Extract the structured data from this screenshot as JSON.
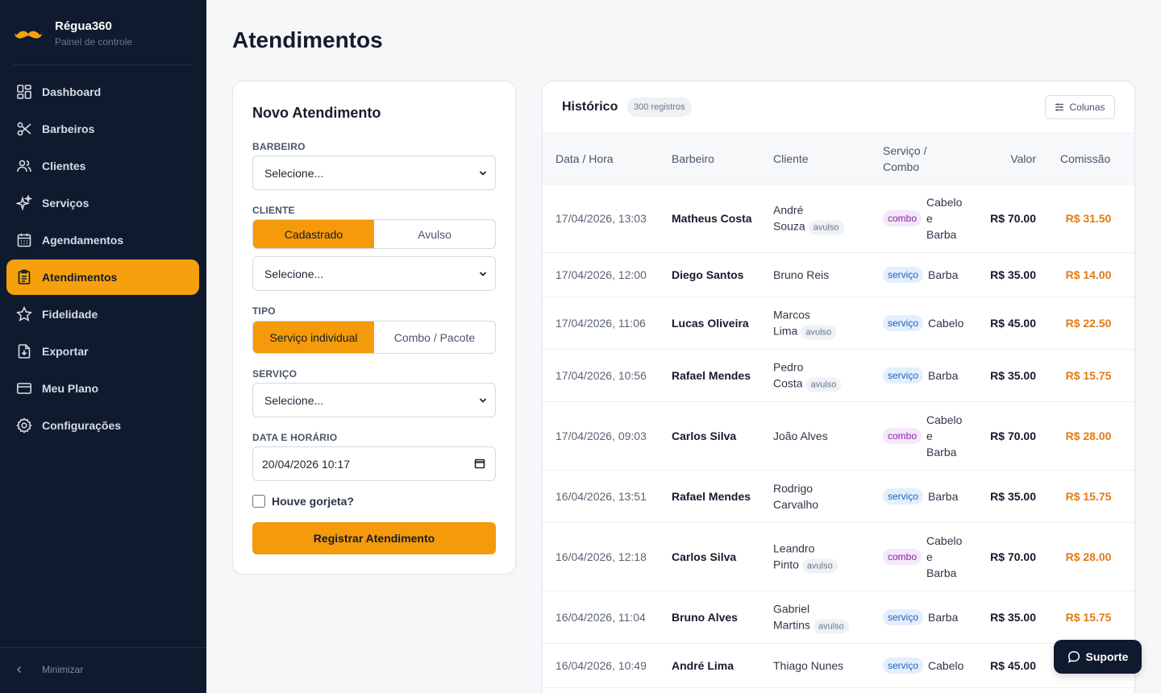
{
  "brand": {
    "name": "Régua360",
    "subtitle": "Painel de controle"
  },
  "sidebar": {
    "items": [
      {
        "label": "Dashboard",
        "icon": "dashboard-icon"
      },
      {
        "label": "Barbeiros",
        "icon": "scissors-icon"
      },
      {
        "label": "Clientes",
        "icon": "users-icon"
      },
      {
        "label": "Serviços",
        "icon": "sparkles-icon"
      },
      {
        "label": "Agendamentos",
        "icon": "calendar-icon"
      },
      {
        "label": "Atendimentos",
        "icon": "clipboard-icon",
        "active": true
      },
      {
        "label": "Fidelidade",
        "icon": "star-icon"
      },
      {
        "label": "Exportar",
        "icon": "export-icon"
      },
      {
        "label": "Meu Plano",
        "icon": "credit-card-icon"
      },
      {
        "label": "Configurações",
        "icon": "gear-icon"
      }
    ],
    "minimize_label": "Minimizar"
  },
  "page": {
    "title": "Atendimentos"
  },
  "form": {
    "title": "Novo Atendimento",
    "barbeiro_label": "BARBEIRO",
    "barbeiro_value": "Selecione...",
    "cliente_label": "CLIENTE",
    "cliente_opt_1": "Cadastrado",
    "cliente_opt_2": "Avulso",
    "cliente_value": "Selecione...",
    "tipo_label": "TIPO",
    "tipo_opt_1": "Serviço individual",
    "tipo_opt_2": "Combo / Pacote",
    "servico_label": "SERVIÇO",
    "servico_value": "Selecione...",
    "data_label": "DATA E HORÁRIO",
    "data_value": "20/04/2026 10:17",
    "gorjeta_label": "Houve gorjeta?",
    "submit_label": "Registrar Atendimento"
  },
  "history": {
    "title": "Histórico",
    "count": "300 registros",
    "columns_button": "Colunas",
    "headers": {
      "data": "Data / Hora",
      "barbeiro": "Barbeiro",
      "cliente": "Cliente",
      "servico_1": "Serviço /",
      "servico_2": "Combo",
      "valor": "Valor",
      "comissao": "Comissão"
    },
    "rows": [
      {
        "data": "17/04/2026, 13:03",
        "barbeiro": "Matheus Costa",
        "cliente_1": "André",
        "cliente_2": "Souza",
        "avulso": "avulso",
        "tag": "combo",
        "servico_1": "Cabelo",
        "servico_2": "e",
        "servico_3": "Barba",
        "valor": "R$ 70.00",
        "comissao": "R$ 31.50"
      },
      {
        "data": "17/04/2026, 12:00",
        "barbeiro": "Diego Santos",
        "cliente_1": "Bruno Reis",
        "tag": "serviço",
        "servico_1": "Barba",
        "valor": "R$ 35.00",
        "comissao": "R$ 14.00"
      },
      {
        "data": "17/04/2026, 11:06",
        "barbeiro": "Lucas Oliveira",
        "cliente_1": "Marcos",
        "cliente_2": "Lima",
        "avulso": "avulso",
        "tag": "serviço",
        "servico_1": "Cabelo",
        "valor": "R$ 45.00",
        "comissao": "R$ 22.50"
      },
      {
        "data": "17/04/2026, 10:56",
        "barbeiro": "Rafael Mendes",
        "cliente_1": "Pedro",
        "cliente_2": "Costa",
        "avulso": "avulso",
        "tag": "serviço",
        "servico_1": "Barba",
        "valor": "R$ 35.00",
        "comissao": "R$ 15.75"
      },
      {
        "data": "17/04/2026, 09:03",
        "barbeiro": "Carlos Silva",
        "cliente_1": "João Alves",
        "tag": "combo",
        "servico_1": "Cabelo",
        "servico_2": "e",
        "servico_3": "Barba",
        "valor": "R$ 70.00",
        "comissao": "R$ 28.00"
      },
      {
        "data": "16/04/2026, 13:51",
        "barbeiro": "Rafael Mendes",
        "cliente_1": "Rodrigo",
        "cliente_2": "Carvalho",
        "tag": "serviço",
        "servico_1": "Barba",
        "valor": "R$ 35.00",
        "comissao": "R$ 15.75"
      },
      {
        "data": "16/04/2026, 12:18",
        "barbeiro": "Carlos Silva",
        "cliente_1": "Leandro",
        "cliente_2": "Pinto",
        "avulso": "avulso",
        "tag": "combo",
        "servico_1": "Cabelo",
        "servico_2": "e",
        "servico_3": "Barba",
        "valor": "R$ 70.00",
        "comissao": "R$ 28.00"
      },
      {
        "data": "16/04/2026, 11:04",
        "barbeiro": "Bruno Alves",
        "cliente_1": "Gabriel",
        "cliente_2": "Martins",
        "avulso": "avulso",
        "tag": "serviço",
        "servico_1": "Barba",
        "valor": "R$ 35.00",
        "comissao": "R$ 15.75"
      },
      {
        "data": "16/04/2026, 10:49",
        "barbeiro": "André Lima",
        "cliente_1": "Thiago Nunes",
        "tag": "serviço",
        "servico_1": "Cabelo",
        "valor": "R$ 45.00",
        "comissao": ""
      }
    ]
  },
  "support": {
    "label": "Suporte"
  },
  "colors": {
    "accent": "#f59a0a",
    "sidebar": "#0f1a2e",
    "commission": "#e07b14"
  }
}
